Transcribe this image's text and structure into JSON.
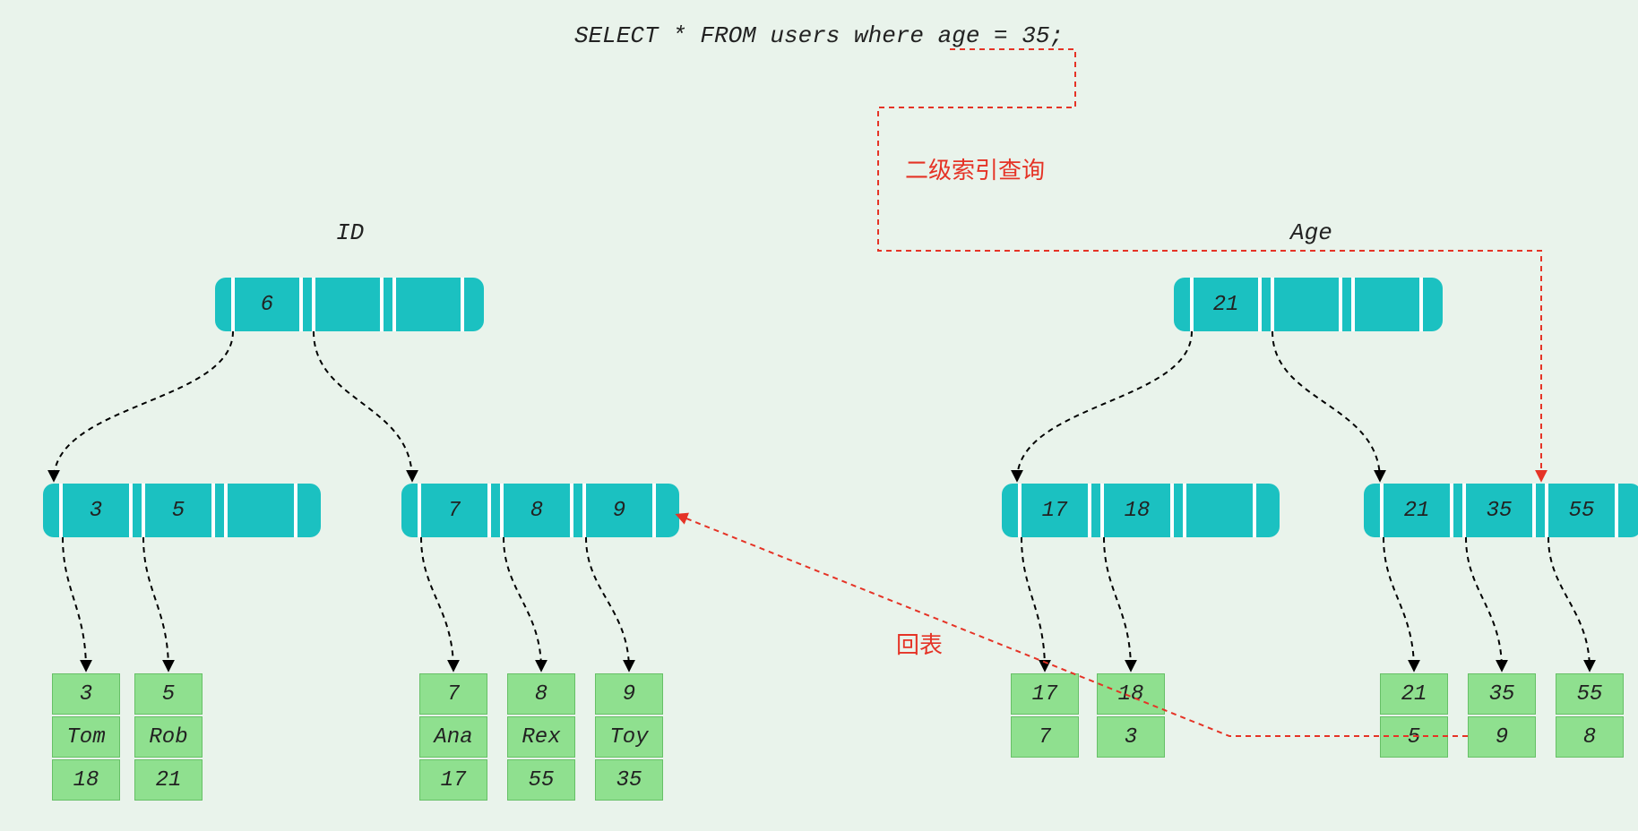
{
  "sql": "SELECT * FROM users where age = 35;",
  "left_tree": {
    "title": "ID",
    "root": {
      "cells": [
        "6",
        "",
        ""
      ]
    },
    "mid": [
      {
        "cells": [
          "3",
          "5",
          ""
        ]
      },
      {
        "cells": [
          "7",
          "8",
          "9"
        ]
      }
    ],
    "leaves": [
      {
        "rows": [
          "3",
          "Tom",
          "18"
        ]
      },
      {
        "rows": [
          "5",
          "Rob",
          "21"
        ]
      },
      {
        "rows": [
          "7",
          "Ana",
          "17"
        ]
      },
      {
        "rows": [
          "8",
          "Rex",
          "55"
        ]
      },
      {
        "rows": [
          "9",
          "Toy",
          "35"
        ]
      }
    ]
  },
  "right_tree": {
    "title": "Age",
    "root": {
      "cells": [
        "21",
        "",
        ""
      ]
    },
    "mid": [
      {
        "cells": [
          "17",
          "18",
          ""
        ]
      },
      {
        "cells": [
          "21",
          "35",
          "55"
        ]
      }
    ],
    "leaves": [
      {
        "rows": [
          "17",
          "7"
        ]
      },
      {
        "rows": [
          "18",
          "3"
        ]
      },
      {
        "rows": [
          "21",
          "5"
        ]
      },
      {
        "rows": [
          "35",
          "9"
        ]
      },
      {
        "rows": [
          "55",
          "8"
        ]
      }
    ]
  },
  "annotations": {
    "secondary_index_query": "二级索引查询",
    "back_to_table": "回表"
  }
}
